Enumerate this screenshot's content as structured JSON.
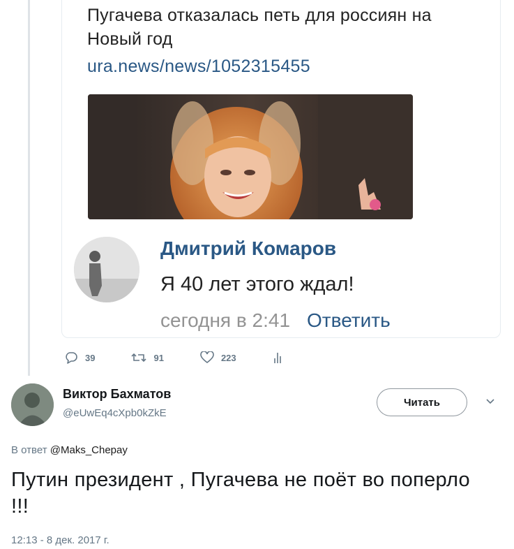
{
  "embedded_post": {
    "headline": "Пугачева отказалась петь для россиян на Новый год",
    "link": "ura.news/news/1052315455",
    "comment": {
      "author": "Дмитрий Комаров",
      "text": "Я 40 лет этого ждал!",
      "time": "сегодня в 2:41",
      "reply_label": "Ответить"
    }
  },
  "quoted_actions": {
    "replies": "39",
    "retweets": "91",
    "likes": "223",
    "icons": [
      "reply-icon",
      "retweet-icon",
      "like-icon",
      "analytics-icon"
    ]
  },
  "tweet": {
    "author_name": "Виктор Бахматов",
    "author_handle": "@eUwEq4cXpb0kZkE",
    "follow_label": "Читать",
    "reply_prefix": "В ответ",
    "reply_handle": "@Maks_Chepay",
    "text": "Путин президент , Пугачева не поёт во поперло !!!",
    "timestamp": "12:13 - 8 дек. 2017 г."
  },
  "colors": {
    "vk_link": "#2a5885",
    "muted": "#657786",
    "text": "#14171a"
  }
}
